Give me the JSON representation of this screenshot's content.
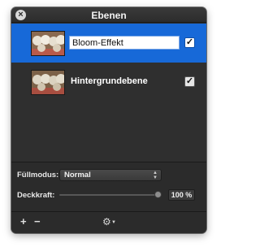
{
  "panel": {
    "title": "Ebenen"
  },
  "layers": [
    {
      "name": "Bloom-Effekt",
      "selected": true,
      "visible_check": "✓",
      "editing": true
    },
    {
      "name": "Hintergrundebene",
      "selected": false,
      "visible_check": "✓",
      "editing": false
    }
  ],
  "blend": {
    "label": "Füllmodus:",
    "value": "Normal"
  },
  "opacity": {
    "label": "Deckkraft:",
    "value_text": "100 %",
    "value_fraction": 1.0
  },
  "footer": {
    "add": "+",
    "remove": "−"
  },
  "colors": {
    "selection": "#1769d8",
    "panel_bg": "#2b2b2b"
  }
}
